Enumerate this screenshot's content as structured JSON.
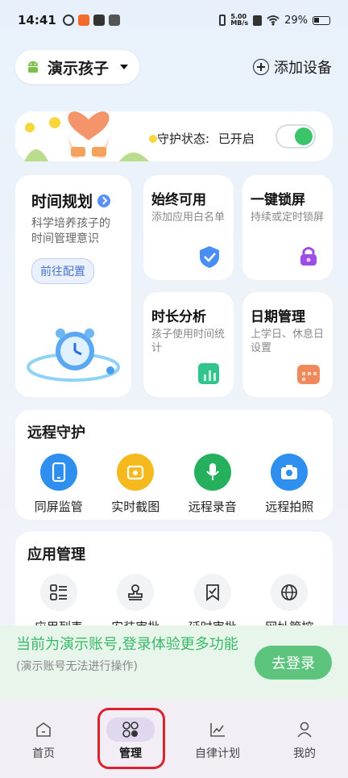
{
  "status_bar": {
    "time": "14:41",
    "net_speed": "5.00\nMB/s",
    "battery": "29%"
  },
  "header": {
    "child_name": "演示孩子",
    "add_device": "添加设备"
  },
  "protection": {
    "label": "守护状态:",
    "state": "已开启"
  },
  "time_plan": {
    "title": "时间规划",
    "desc": "科学培养孩子的时间管理意识",
    "button": "前往配置"
  },
  "cards": [
    {
      "title": "始终可用",
      "desc": "添加应用白名单",
      "color": "#4a8df3"
    },
    {
      "title": "一键锁屏",
      "desc": "持续或定时锁屏",
      "color": "#9a4ee8"
    },
    {
      "title": "时长分析",
      "desc": "孩子使用时间统计",
      "color": "#31c48d"
    },
    {
      "title": "日期管理",
      "desc": "上学日、休息日设置",
      "color": "#f08a5d"
    }
  ],
  "remote": {
    "title": "远程守护",
    "items": [
      {
        "label": "同屏监管",
        "icon": "phone-icon",
        "color": "#2f8fef"
      },
      {
        "label": "实时截图",
        "icon": "screenshot-icon",
        "color": "#f5b81d"
      },
      {
        "label": "远程录音",
        "icon": "microphone-icon",
        "color": "#25b05e"
      },
      {
        "label": "远程拍照",
        "icon": "camera-icon",
        "color": "#2f8fef"
      }
    ]
  },
  "apps": {
    "title": "应用管理",
    "items": [
      {
        "label": "应用列表",
        "icon": "list-icon"
      },
      {
        "label": "安装审批",
        "icon": "stamp-icon"
      },
      {
        "label": "延时审批",
        "icon": "bookmark-check-icon"
      },
      {
        "label": "网址管控",
        "icon": "globe-icon"
      }
    ]
  },
  "login": {
    "message": "当前为演示账号,登录体验更多功能",
    "note": "(演示账号无法进行操作)",
    "button": "去登录"
  },
  "tabs": [
    {
      "label": "首页",
      "icon": "home-icon"
    },
    {
      "label": "管理",
      "icon": "grid-icon"
    },
    {
      "label": "自律计划",
      "icon": "chart-icon"
    },
    {
      "label": "我的",
      "icon": "user-icon"
    }
  ]
}
